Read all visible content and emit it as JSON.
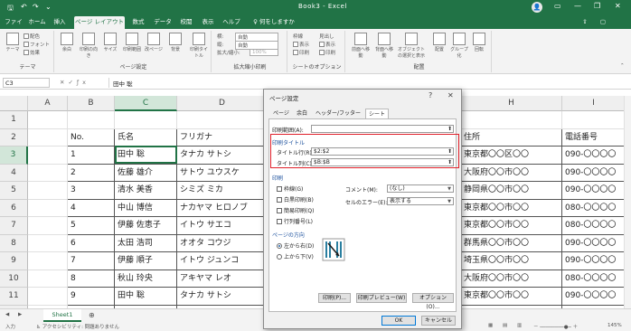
{
  "titlebar": {
    "doc_title": "Book3 - Excel",
    "avatar": "👤"
  },
  "tabs": [
    "ファイル",
    "ホーム",
    "挿入",
    "ページ レイアウト",
    "数式",
    "データ",
    "校閲",
    "表示",
    "ヘルプ",
    "何をしますか"
  ],
  "ribbon": {
    "theme_group": {
      "label": "テーマ",
      "big": "テーマ",
      "items": [
        "配色",
        "フォント",
        "効果"
      ]
    },
    "page_setup": {
      "label": "ページ設定",
      "items": [
        "余白",
        "印刷の向き",
        "サイズ",
        "印刷範囲",
        "改ページ",
        "背景",
        "印刷タイトル"
      ]
    },
    "scale": {
      "label": "拡大縮小印刷",
      "width": "横:",
      "width_val": "自動",
      "height": "縦:",
      "height_val": "自動",
      "ratio": "拡大/縮小:",
      "ratio_val": "100%"
    },
    "sheet_opts": {
      "label": "シートのオプション",
      "grid": "枠線",
      "heading": "見出し",
      "view": "表示",
      "print": "印刷"
    },
    "arrange": {
      "label": "配置",
      "items": [
        "前面へ移動",
        "背面へ移動",
        "オブジェクトの選択と表示",
        "配置",
        "グループ化",
        "回転"
      ]
    }
  },
  "formula": {
    "namebox": "C3",
    "value": "田中 聡"
  },
  "columns": [
    "A",
    "B",
    "C",
    "D",
    "H",
    "I"
  ],
  "rows": [
    "1",
    "2",
    "3",
    "4",
    "5",
    "6",
    "7",
    "8",
    "9",
    "10",
    "11",
    "12"
  ],
  "table": {
    "headers": [
      "No.",
      "氏名",
      "フリガナ",
      "住所",
      "電話番号"
    ],
    "data": [
      [
        "1",
        "田中 聡",
        "タナカ サトシ",
        "東京都〇〇区〇〇",
        "090-〇〇〇〇"
      ],
      [
        "2",
        "佐藤 雄介",
        "サトウ ユウスケ",
        "大阪府〇〇市〇〇",
        "090-〇〇〇〇"
      ],
      [
        "3",
        "清水 美香",
        "シミズ ミカ",
        "静岡県〇〇市〇〇",
        "090-〇〇〇〇"
      ],
      [
        "4",
        "中山 博信",
        "ナカヤマ ヒロノブ",
        "東京都〇〇市〇〇",
        "080-〇〇〇〇"
      ],
      [
        "5",
        "伊藤 佐恵子",
        "イトウ サエコ",
        "東京都〇〇市〇〇",
        "080-〇〇〇〇"
      ],
      [
        "6",
        "太田 浩司",
        "オオタ コウジ",
        "群馬県〇〇市〇〇",
        "090-〇〇〇〇"
      ],
      [
        "7",
        "伊藤 順子",
        "イトウ ジュンコ",
        "埼玉県〇〇市〇〇",
        "090-〇〇〇〇"
      ],
      [
        "8",
        "秋山 玲央",
        "アキヤマ レオ",
        "大阪府〇〇市〇〇",
        "080-〇〇〇〇"
      ],
      [
        "9",
        "田中 聡",
        "タナカ サトシ",
        "東京都〇〇市〇〇",
        "090-〇〇〇〇"
      ],
      [
        "10",
        "佐藤 雄介",
        "サトウ ユウスケ",
        "大阪府〇〇市〇〇",
        "090-〇〇〇〇"
      ]
    ]
  },
  "sheet_tab": "Sheet1",
  "status": {
    "mode": "入力",
    "accessibility": "アクセシビリティ: 問題ありません",
    "zoom": "145%"
  },
  "dialog": {
    "title": "ページ設定",
    "help": "?",
    "close": "✕",
    "tabs": [
      "ページ",
      "余白",
      "ヘッダー/フッター",
      "シート"
    ],
    "print_area_label": "印刷範囲(A):",
    "print_area_value": "",
    "print_titles_label": "印刷タイトル",
    "title_rows_label": "タイトル行(R):",
    "title_rows_value": "$2:$2",
    "title_cols_label": "タイトル列(C):",
    "title_cols_value": "$B:$B",
    "print_label": "印刷",
    "chk_grid": "枠線(G)",
    "chk_mono": "白黒印刷(B)",
    "chk_draft": "簡易印刷(Q)",
    "chk_rowcol": "行列番号(L)",
    "comment_label": "コメント(M):",
    "comment_value": "(なし)",
    "error_label": "セルのエラー(E):",
    "error_value": "表示する",
    "order_label": "ページの方向",
    "radio_lr": "左から右(D)",
    "radio_tb": "上から下(V)",
    "btn_print": "印刷(P)...",
    "btn_preview": "印刷プレビュー(W)",
    "btn_options": "オプション(O)...",
    "btn_ok": "OK",
    "btn_cancel": "キャンセル",
    "picker": "⬆"
  }
}
